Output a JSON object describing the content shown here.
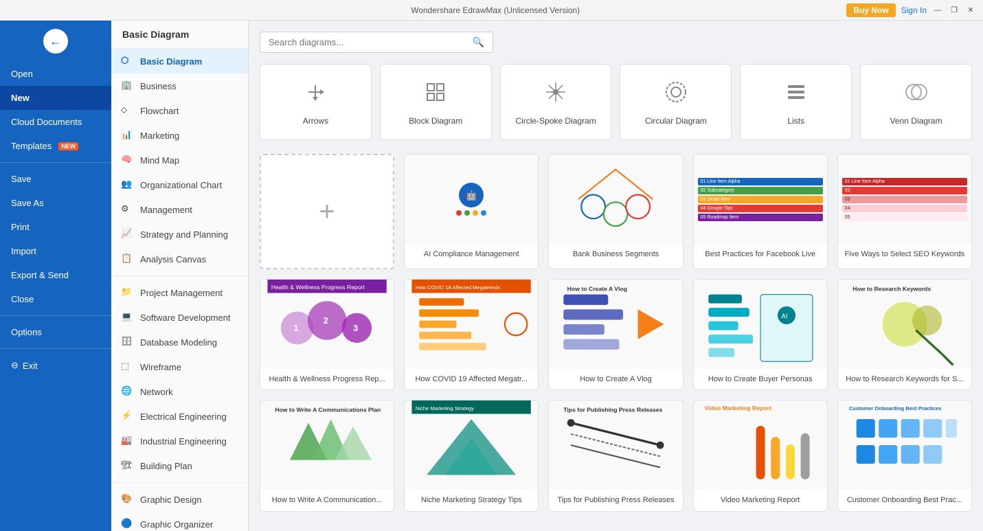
{
  "titlebar": {
    "title": "Wondershare EdrawMax (Unlicensed Version)",
    "minimize": "—",
    "maximize": "❐",
    "close": "✕",
    "buy_now": "Buy Now",
    "sign_in": "Sign In"
  },
  "sidebar": {
    "logo_letter": "←",
    "items": [
      {
        "id": "open",
        "label": "Open",
        "active": false
      },
      {
        "id": "new",
        "label": "New",
        "active": true,
        "badge": ""
      },
      {
        "id": "cloud",
        "label": "Cloud Documents",
        "active": false
      },
      {
        "id": "templates",
        "label": "Templates",
        "active": false,
        "badge": "NEW"
      },
      {
        "id": "save",
        "label": "Save",
        "active": false
      },
      {
        "id": "save-as",
        "label": "Save As",
        "active": false
      },
      {
        "id": "print",
        "label": "Print",
        "active": false
      },
      {
        "id": "import",
        "label": "Import",
        "active": false
      },
      {
        "id": "export",
        "label": "Export & Send",
        "active": false
      },
      {
        "id": "close",
        "label": "Close",
        "active": false
      },
      {
        "id": "options",
        "label": "Options",
        "active": false
      },
      {
        "id": "exit",
        "label": "Exit",
        "active": false
      }
    ]
  },
  "middle_panel": {
    "header": "Basic Diagram",
    "items": [
      {
        "id": "basic",
        "label": "Basic Diagram",
        "active": true
      },
      {
        "id": "business",
        "label": "Business",
        "active": false
      },
      {
        "id": "flowchart",
        "label": "Flowchart",
        "active": false
      },
      {
        "id": "marketing",
        "label": "Marketing",
        "active": false
      },
      {
        "id": "mindmap",
        "label": "Mind Map",
        "active": false
      },
      {
        "id": "orgchart",
        "label": "Organizational Chart",
        "active": false
      },
      {
        "id": "management",
        "label": "Management",
        "active": false
      },
      {
        "id": "strategy",
        "label": "Strategy and Planning",
        "active": false
      },
      {
        "id": "analysis",
        "label": "Analysis Canvas",
        "active": false
      },
      {
        "id": "project",
        "label": "Project Management",
        "active": false
      },
      {
        "id": "software",
        "label": "Software Development",
        "active": false
      },
      {
        "id": "database",
        "label": "Database Modeling",
        "active": false
      },
      {
        "id": "wireframe",
        "label": "Wireframe",
        "active": false
      },
      {
        "id": "network",
        "label": "Network",
        "active": false
      },
      {
        "id": "electrical",
        "label": "Electrical Engineering",
        "active": false
      },
      {
        "id": "industrial",
        "label": "Industrial Engineering",
        "active": false
      },
      {
        "id": "building",
        "label": "Building Plan",
        "active": false
      },
      {
        "id": "graphic",
        "label": "Graphic Design",
        "active": false
      },
      {
        "id": "organizer",
        "label": "Graphic Organizer",
        "active": false
      }
    ]
  },
  "search": {
    "placeholder": "Search diagrams..."
  },
  "categories": [
    {
      "id": "arrows",
      "label": "Arrows",
      "icon": "↗"
    },
    {
      "id": "block",
      "label": "Block Diagram",
      "icon": "⬜"
    },
    {
      "id": "spoke",
      "label": "Circle-Spoke Diagram",
      "icon": "✳"
    },
    {
      "id": "circular",
      "label": "Circular Diagram",
      "icon": "◎"
    },
    {
      "id": "lists",
      "label": "Lists",
      "icon": "≡"
    },
    {
      "id": "venn",
      "label": "Venn Diagram",
      "icon": "⊕"
    }
  ],
  "templates": [
    {
      "id": "add-new",
      "label": "",
      "type": "add-new"
    },
    {
      "id": "ai-compliance",
      "label": "AI Compliance Management",
      "type": "ai"
    },
    {
      "id": "bank-segments",
      "label": "Bank Business Segments",
      "type": "bank"
    },
    {
      "id": "fb-live",
      "label": "Best Practices for Facebook Live",
      "type": "fb"
    },
    {
      "id": "seo-keywords",
      "label": "Five Ways to Select SEO Keywords",
      "type": "seo"
    },
    {
      "id": "health",
      "label": "Health & Wellness Progress Rep...",
      "type": "health"
    },
    {
      "id": "covid",
      "label": "How COVID 19 Affected Megatr...",
      "type": "covid"
    },
    {
      "id": "vlog",
      "label": "How to Create A Vlog",
      "type": "vlog"
    },
    {
      "id": "buyer",
      "label": "How to Create Buyer Personas",
      "type": "buyer"
    },
    {
      "id": "keywords",
      "label": "How to Research Keywords for S...",
      "type": "keywords"
    },
    {
      "id": "comm-plan",
      "label": "How to Write A Communication...",
      "type": "comm"
    },
    {
      "id": "niche",
      "label": "Niche Marketing Strategy Tips",
      "type": "niche"
    },
    {
      "id": "press",
      "label": "Tips for Publishing Press Releases",
      "type": "press"
    },
    {
      "id": "video",
      "label": "Video Marketing Report",
      "type": "video"
    },
    {
      "id": "onboard",
      "label": "Customer Onboarding Best Prac...",
      "type": "onboard"
    }
  ]
}
